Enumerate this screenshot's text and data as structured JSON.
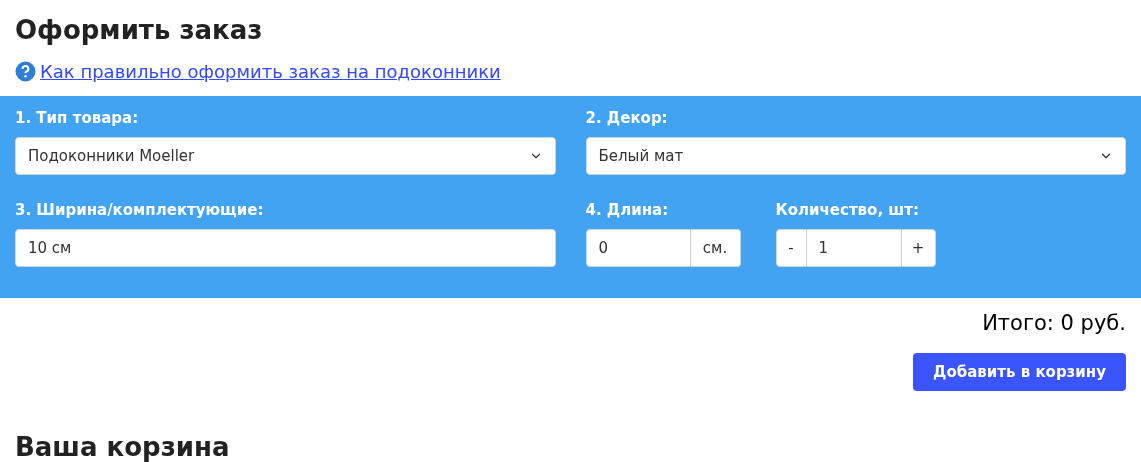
{
  "title": "Оформить заказ",
  "help_link": "Как правильно оформить заказ на подоконники",
  "form": {
    "product_type": {
      "label": "1. Тип товара:",
      "value": "Подоконники Moeller"
    },
    "decor": {
      "label": "2. Декор:",
      "value": "Белый мат"
    },
    "width": {
      "label": "3. Ширина/комплектующие:",
      "value": "10 см"
    },
    "length": {
      "label": "4. Длина:",
      "value": "0",
      "unit": "см."
    },
    "quantity": {
      "label": "Количество, шт:",
      "minus": "-",
      "value": "1",
      "plus": "+"
    }
  },
  "total": "Итого: 0 руб.",
  "add_button": "Добавить в корзину",
  "cart_heading": "Ваша корзина"
}
